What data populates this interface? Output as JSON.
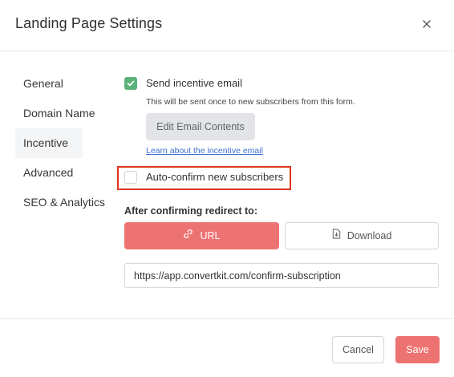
{
  "dialog": {
    "title": "Landing Page Settings",
    "close_icon": "close-icon"
  },
  "sidebar": {
    "items": [
      {
        "label": "General",
        "active": false
      },
      {
        "label": "Domain Name",
        "active": false
      },
      {
        "label": "Incentive",
        "active": true
      },
      {
        "label": "Advanced",
        "active": false
      },
      {
        "label": "SEO & Analytics",
        "active": false
      }
    ]
  },
  "incentive": {
    "send_email": {
      "label": "Send incentive email",
      "checked": true,
      "helper": "This will be sent once to new subscribers from this form."
    },
    "edit_button_label": "Edit Email Contents",
    "learn_link_label": "Learn about the incentive email",
    "auto_confirm": {
      "label": "Auto-confirm new subscribers",
      "checked": false
    },
    "redirect": {
      "label": "After confirming redirect to:",
      "url_button_label": "URL",
      "url_icon": "link-icon",
      "download_button_label": "Download",
      "download_icon": "file-download-icon",
      "selected": "URL",
      "url_value": "https://app.convertkit.com/confirm-subscription"
    }
  },
  "footer": {
    "cancel_label": "Cancel",
    "save_label": "Save"
  },
  "colors": {
    "accent": "#ed7372",
    "check_green": "#5bb27a",
    "link_blue": "#3d6fd1",
    "highlight_red": "#e0331e"
  }
}
